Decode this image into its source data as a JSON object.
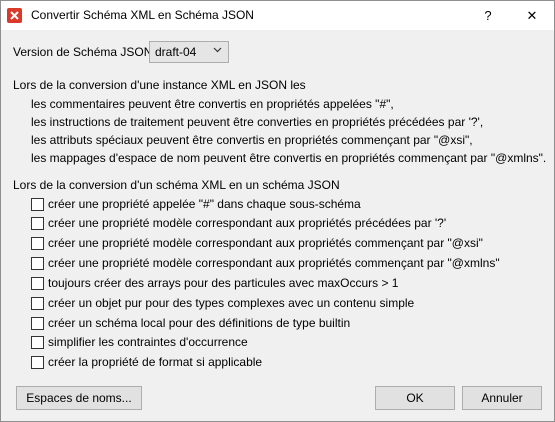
{
  "window": {
    "title": "Convertir Schéma XML en Schéma JSON",
    "help_glyph": "?",
    "close_glyph": "✕",
    "icon": "app-x-icon"
  },
  "version": {
    "label": "Version de Schéma JSON:",
    "selected": "draft-04",
    "icon": "chevron-down-icon"
  },
  "instance_section": {
    "heading": "Lors de la conversion d'une instance XML en JSON les",
    "lines": [
      "les commentaires peuvent être convertis en propriétés appelées \"#\",",
      "les instructions de traitement peuvent être converties en propriétés précédées par '?',",
      "les attributs spéciaux peuvent être convertis en propriétés commençant par \"@xsi\",",
      "les mappages d'espace de nom peuvent être convertis en propriétés commençant par \"@xmlns\"."
    ]
  },
  "schema_section": {
    "heading": "Lors de la conversion d'un schéma XML en un schéma JSON",
    "options": [
      "créer une propriété appelée \"#\" dans chaque sous-schéma",
      "créer une propriété modèle correspondant aux propriétés précédées par '?'",
      "créer une propriété modèle correspondant aux propriétés commençant par \"@xsi\"",
      "créer une propriété modèle correspondant aux propriétés commençant par \"@xmlns\"",
      "toujours créer des arrays pour des particules avec maxOccurs > 1",
      "créer un objet pur pour des types complexes avec un contenu simple",
      "créer un schéma local pour des définitions de type builtin",
      "simplifier les contraintes d'occurrence",
      "créer la propriété de format si applicable"
    ]
  },
  "buttons": {
    "namespaces": "Espaces de noms...",
    "ok": "OK",
    "cancel": "Annuler"
  }
}
